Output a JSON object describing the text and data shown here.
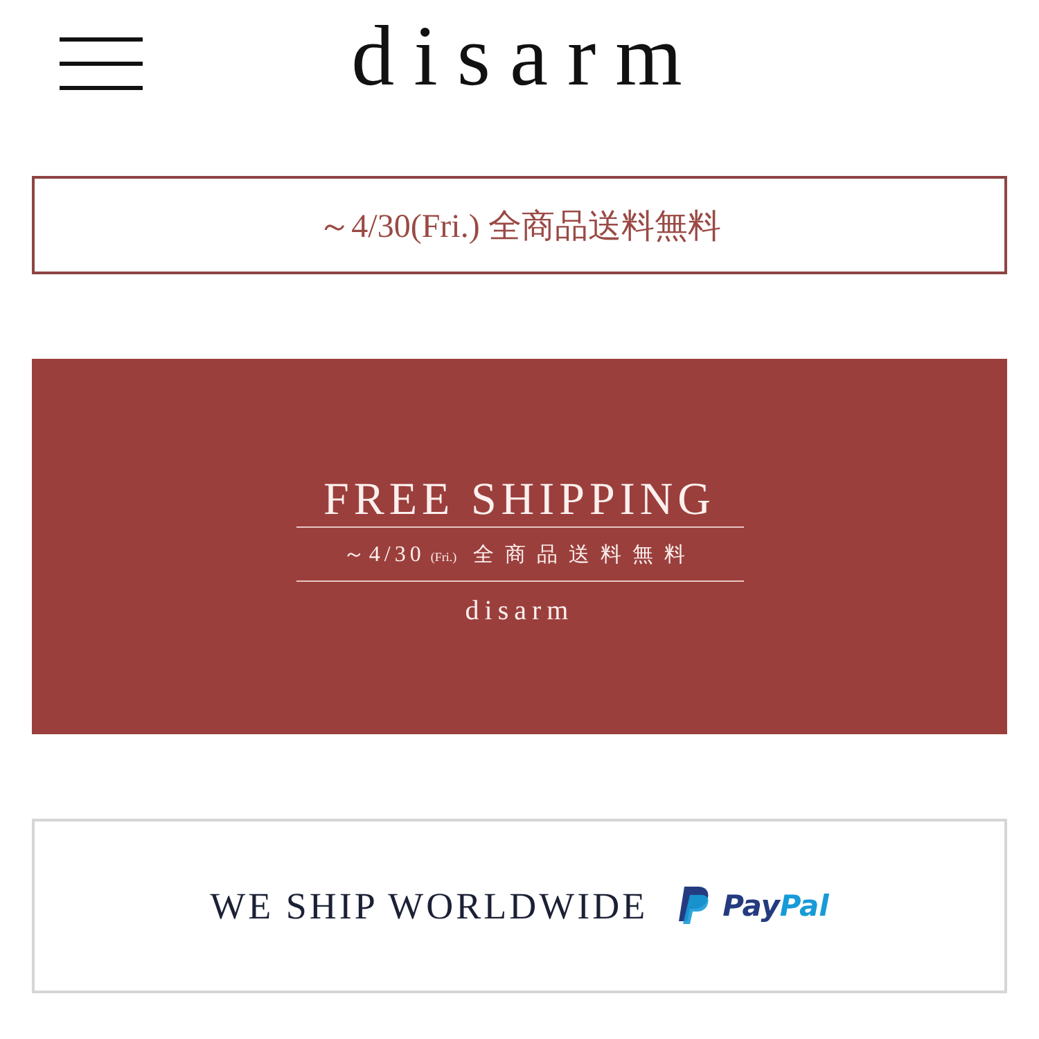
{
  "header": {
    "logo": "disarm"
  },
  "notice": {
    "text": "～4/30(Fri.) 全商品送料無料"
  },
  "banner": {
    "title": "FREE SHIPPING",
    "date": "～4/30",
    "day": "(Fri.)",
    "subtitle": "全商品送料無料",
    "brand": "disarm"
  },
  "shipping": {
    "text": "WE SHIP WORLDWIDE",
    "paypal_pay": "Pay",
    "paypal_pal": "Pal"
  }
}
